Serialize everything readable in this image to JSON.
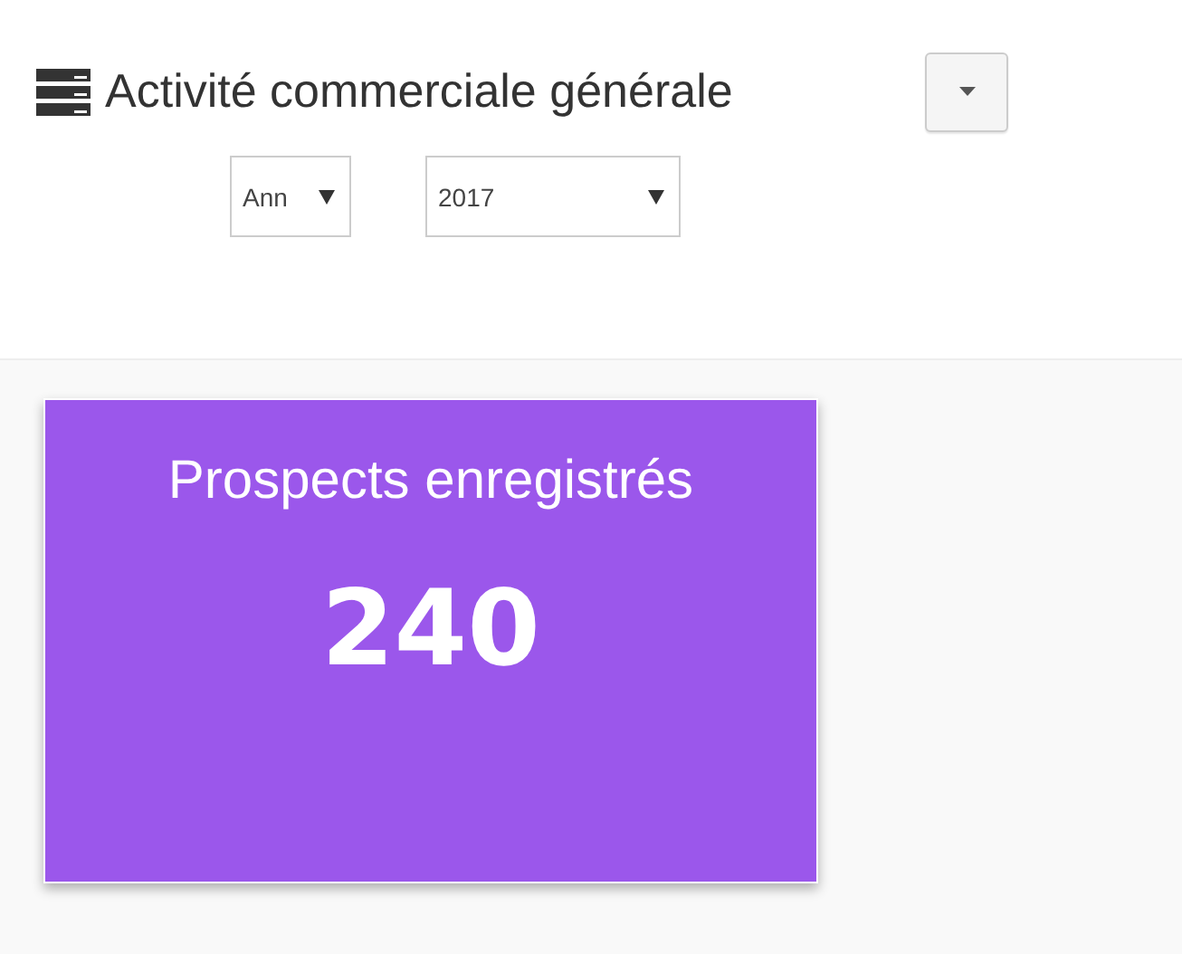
{
  "header": {
    "title": "Activité commerciale générale"
  },
  "filters": [
    {
      "value": "Ann"
    },
    {
      "value": "2017"
    }
  ],
  "card": {
    "label": "Prospects enregistrés",
    "value": "240",
    "color": "#9b57eb"
  }
}
